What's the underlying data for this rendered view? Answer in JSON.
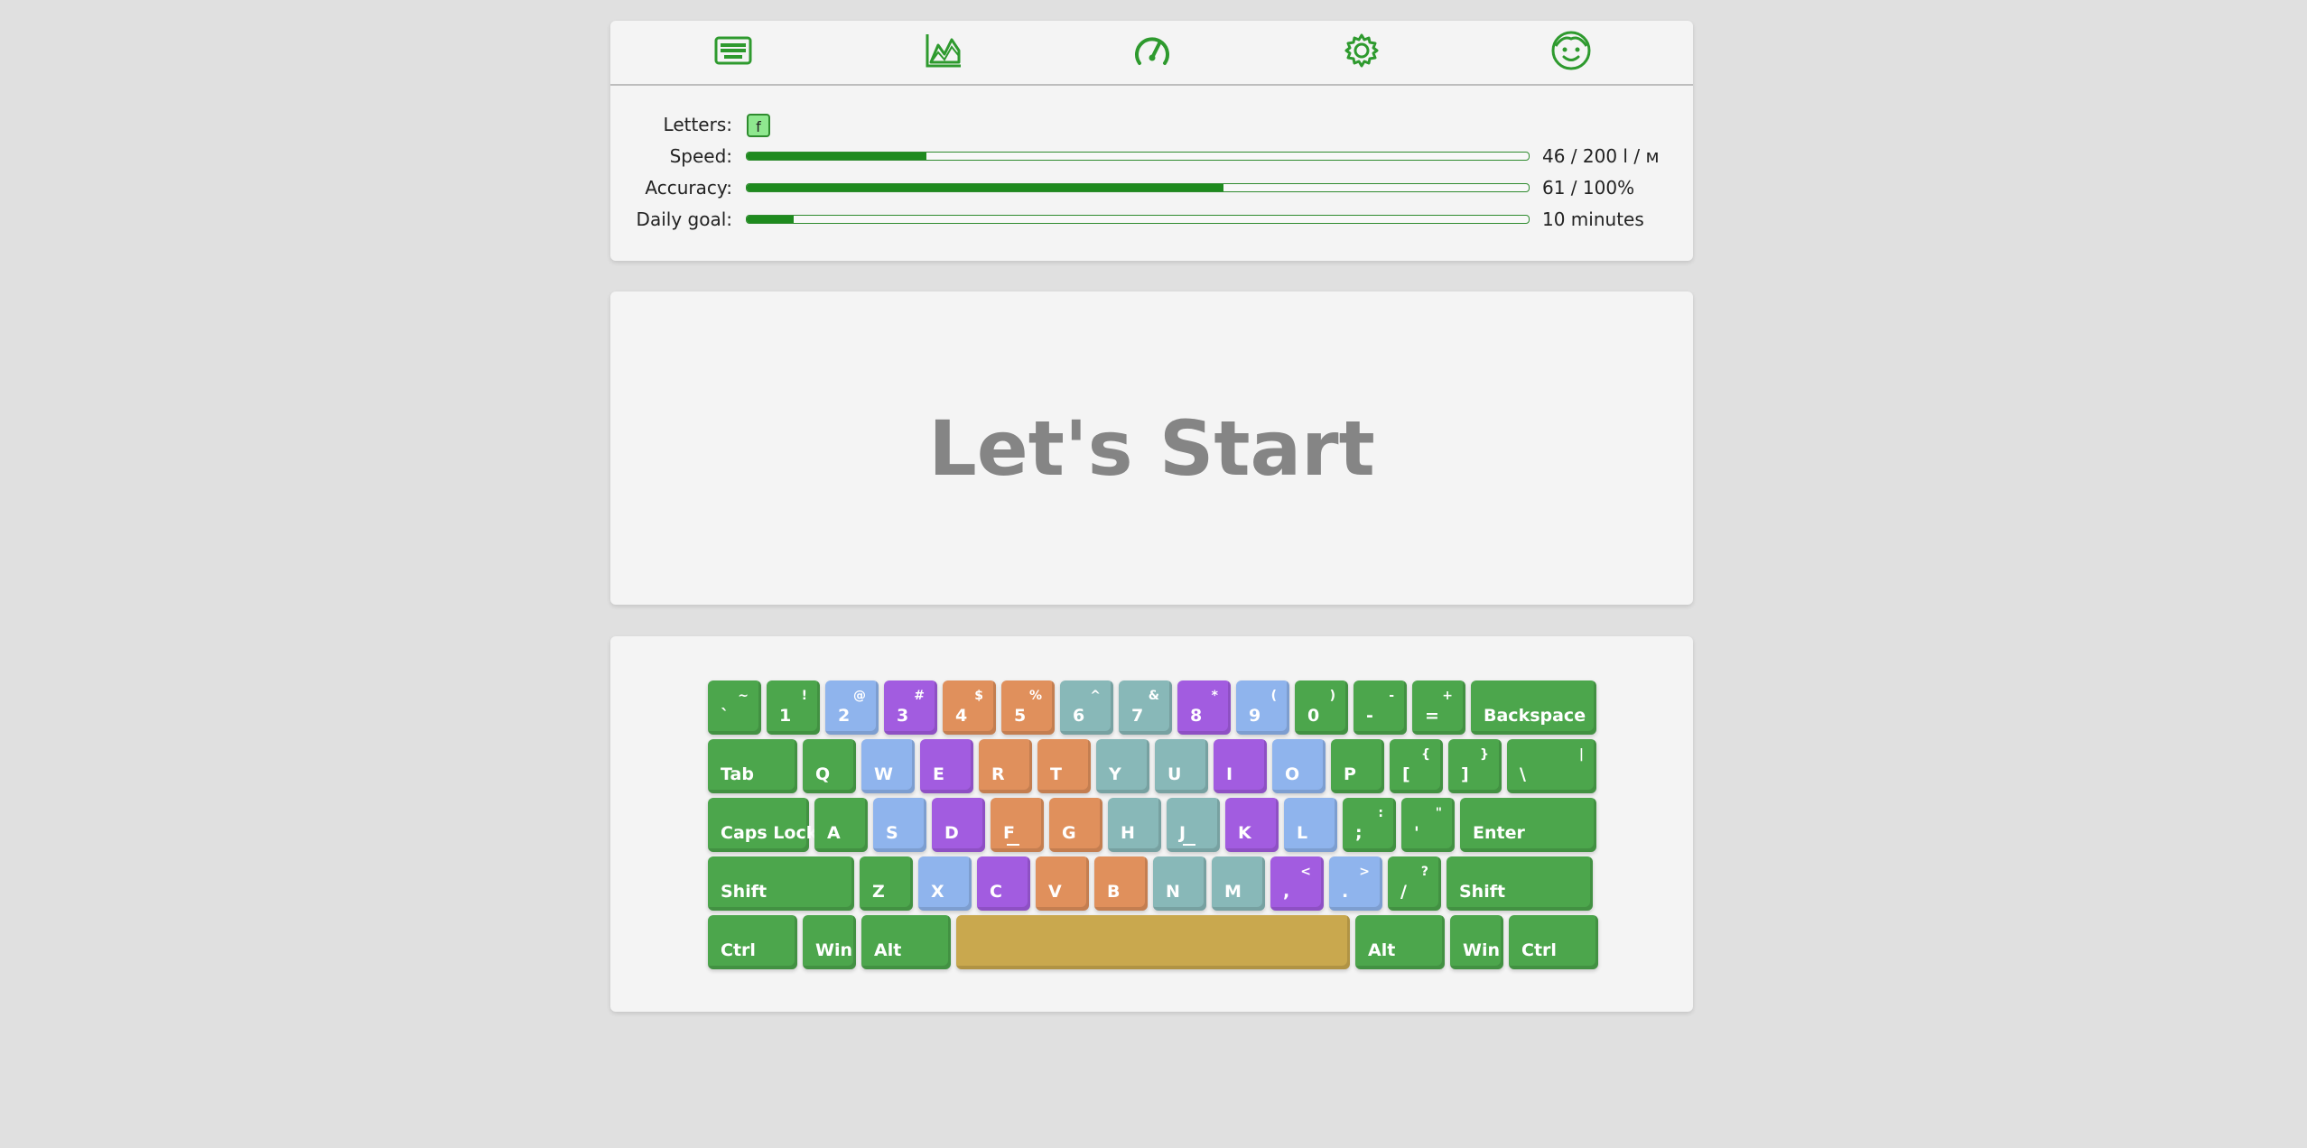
{
  "nav": {
    "items": [
      {
        "name": "practice-nav",
        "icon": "keyboard-icon"
      },
      {
        "name": "stats-nav",
        "icon": "chart-icon"
      },
      {
        "name": "speed-nav",
        "icon": "speedometer-icon"
      },
      {
        "name": "settings-nav",
        "icon": "gear-icon"
      },
      {
        "name": "profile-nav",
        "icon": "face-icon"
      }
    ]
  },
  "stats": {
    "letters_label": "Letters:",
    "letters": [
      "f"
    ],
    "speed_label": "Speed:",
    "speed_value": "46 / 200 l / м",
    "speed_fraction": 0.23,
    "accuracy_label": "Accuracy:",
    "accuracy_value": "61 / 100%",
    "accuracy_fraction": 0.61,
    "goal_label": "Daily goal:",
    "goal_value": "10 minutes",
    "goal_fraction": 0.06
  },
  "main": {
    "title": "Let's Start"
  },
  "keyboard": {
    "rows": [
      [
        {
          "main": "`",
          "shift": "~",
          "color": "green"
        },
        {
          "main": "1",
          "shift": "!",
          "color": "green"
        },
        {
          "main": "2",
          "shift": "@",
          "color": "blue"
        },
        {
          "main": "3",
          "shift": "#",
          "color": "purple"
        },
        {
          "main": "4",
          "shift": "$",
          "color": "orange"
        },
        {
          "main": "5",
          "shift": "%",
          "color": "orange"
        },
        {
          "main": "6",
          "shift": "^",
          "color": "teal"
        },
        {
          "main": "7",
          "shift": "&",
          "color": "teal"
        },
        {
          "main": "8",
          "shift": "*",
          "color": "purple"
        },
        {
          "main": "9",
          "shift": "(",
          "color": "blue"
        },
        {
          "main": "0",
          "shift": ")",
          "color": "green"
        },
        {
          "main": "-",
          "shift": "-",
          "color": "green"
        },
        {
          "main": "=",
          "shift": "+",
          "color": "green"
        },
        {
          "main": "Backspace",
          "shift": "",
          "color": "green"
        }
      ],
      [
        {
          "main": "Tab",
          "shift": "",
          "color": "green"
        },
        {
          "main": "Q",
          "shift": "",
          "color": "green"
        },
        {
          "main": "W",
          "shift": "",
          "color": "blue"
        },
        {
          "main": "E",
          "shift": "",
          "color": "purple"
        },
        {
          "main": "R",
          "shift": "",
          "color": "orange"
        },
        {
          "main": "T",
          "shift": "",
          "color": "orange"
        },
        {
          "main": "Y",
          "shift": "",
          "color": "teal"
        },
        {
          "main": "U",
          "shift": "",
          "color": "teal"
        },
        {
          "main": "I",
          "shift": "",
          "color": "purple"
        },
        {
          "main": "O",
          "shift": "",
          "color": "blue"
        },
        {
          "main": "P",
          "shift": "",
          "color": "green"
        },
        {
          "main": "[",
          "shift": "{",
          "color": "green"
        },
        {
          "main": "]",
          "shift": "}",
          "color": "green"
        },
        {
          "main": "\\",
          "shift": "|",
          "color": "green"
        }
      ],
      [
        {
          "main": "Caps Lock",
          "shift": "",
          "color": "green"
        },
        {
          "main": "A",
          "shift": "",
          "color": "green"
        },
        {
          "main": "S",
          "shift": "",
          "color": "blue"
        },
        {
          "main": "D",
          "shift": "",
          "color": "purple"
        },
        {
          "main": "F",
          "shift": "",
          "color": "orange",
          "bump": true
        },
        {
          "main": "G",
          "shift": "",
          "color": "orange"
        },
        {
          "main": "H",
          "shift": "",
          "color": "teal"
        },
        {
          "main": "J",
          "shift": "",
          "color": "teal",
          "bump": true
        },
        {
          "main": "K",
          "shift": "",
          "color": "purple"
        },
        {
          "main": "L",
          "shift": "",
          "color": "blue"
        },
        {
          "main": ";",
          "shift": ":",
          "color": "green"
        },
        {
          "main": "'",
          "shift": "\"",
          "color": "green"
        },
        {
          "main": "Enter",
          "shift": "",
          "color": "green"
        }
      ],
      [
        {
          "main": "Shift",
          "shift": "",
          "color": "green"
        },
        {
          "main": "Z",
          "shift": "",
          "color": "green"
        },
        {
          "main": "X",
          "shift": "",
          "color": "blue"
        },
        {
          "main": "C",
          "shift": "",
          "color": "purple"
        },
        {
          "main": "V",
          "shift": "",
          "color": "orange"
        },
        {
          "main": "B",
          "shift": "",
          "color": "orange"
        },
        {
          "main": "N",
          "shift": "",
          "color": "teal"
        },
        {
          "main": "M",
          "shift": "",
          "color": "teal"
        },
        {
          "main": ",",
          "shift": "<",
          "color": "purple"
        },
        {
          "main": ".",
          "shift": ">",
          "color": "blue"
        },
        {
          "main": "/",
          "shift": "?",
          "color": "green"
        },
        {
          "main": "Shift",
          "shift": "",
          "color": "green"
        }
      ],
      [
        {
          "main": "Ctrl",
          "shift": "",
          "color": "green"
        },
        {
          "main": "Win",
          "shift": "",
          "color": "green"
        },
        {
          "main": "Alt",
          "shift": "",
          "color": "green"
        },
        {
          "main": "",
          "shift": "",
          "color": "gold",
          "space": true
        },
        {
          "main": "Alt",
          "shift": "",
          "color": "green"
        },
        {
          "main": "Win",
          "shift": "",
          "color": "green"
        },
        {
          "main": "Ctrl",
          "shift": "",
          "color": "green"
        }
      ]
    ],
    "colors": {
      "green": "#4ca64c",
      "blue": "#8fb4ed",
      "purple": "#a25ce0",
      "orange": "#e0905c",
      "teal": "#88b8b8",
      "gold": "#c9a84e"
    }
  }
}
